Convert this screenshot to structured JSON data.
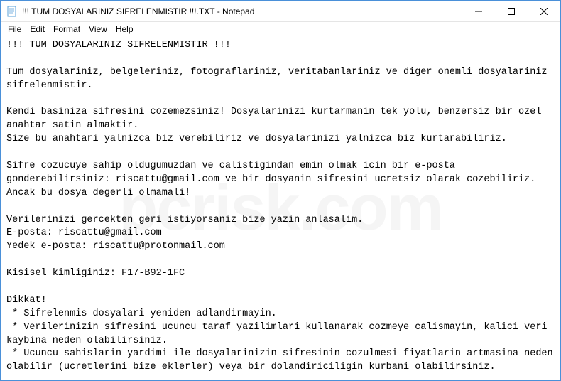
{
  "window": {
    "title": "!!! TUM DOSYALARINIZ SIFRELENMISTIR !!!.TXT - Notepad"
  },
  "menu": {
    "file": "File",
    "edit": "Edit",
    "format": "Format",
    "view": "View",
    "help": "Help"
  },
  "document": {
    "text": "!!! TUM DOSYALARINIZ SIFRELENMISTIR !!!\n\nTum dosyalariniz, belgeleriniz, fotograflariniz, veritabanlariniz ve diger onemli dosyalariniz sifrelenmistir.\n\nKendi basiniza sifresini cozemezsiniz! Dosyalarinizi kurtarmanin tek yolu, benzersiz bir ozel anahtar satin almaktir.\nSize bu anahtari yalnizca biz verebiliriz ve dosyalarinizi yalnizca biz kurtarabiliriz.\n\nSifre cozucuye sahip oldugumuzdan ve calistigindan emin olmak icin bir e-posta gonderebilirsiniz: riscattu@gmail.com ve bir dosyanin sifresini ucretsiz olarak cozebiliriz.\nAncak bu dosya degerli olmamali!\n\nVerilerinizi gercekten geri istiyorsaniz bize yazin anlasalim.\nE-posta: riscattu@gmail.com\nYedek e-posta: riscattu@protonmail.com\n\nKisisel kimliginiz: F17-B92-1FC\n\nDikkat!\n * Sifrelenmis dosyalari yeniden adlandirmayin.\n * Verilerinizin sifresini ucuncu taraf yazilimlari kullanarak cozmeye calismayin, kalici veri kaybina neden olabilirsiniz.\n * Ucuncu sahislarin yardimi ile dosyalarinizin sifresinin cozulmesi fiyatlarin artmasina neden olabilir (ucretlerini bize eklerler) veya bir dolandiriciligin kurbani olabilirsiniz."
  },
  "watermark": {
    "text": "pcrisk.com"
  }
}
